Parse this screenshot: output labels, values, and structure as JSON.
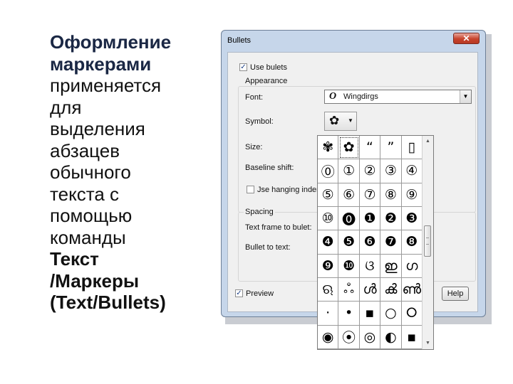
{
  "slide": {
    "title_line1": "Оформление",
    "title_line2": "маркерами",
    "body_lines": [
      "применяется",
      "для",
      "выделения",
      "абзацев",
      "обычного",
      "текста с",
      "помощью",
      "команды"
    ],
    "command_line1": "Текст",
    "command_line2": "/Маркеры",
    "command_line3": "(Text/Bullets)"
  },
  "dialog": {
    "title": "Bullets",
    "close_glyph": "✕",
    "use_bullets_label": "Use bulets",
    "use_bullets_checked": true,
    "appearance_label": "Appearance",
    "font_label": "Font:",
    "font_value": "Wingdirgs",
    "font_type_glyph": "O",
    "symbol_label": "Symbol:",
    "symbol_glyph": "✿",
    "size_label": "Size:",
    "baseline_label": "Baseline shift:",
    "hanging_label": "Jse hanging indent",
    "hanging_checked": false,
    "spacing_label": "Spacing",
    "text_frame_label": "Text frame to bulet:",
    "bullet_to_text_label": "Bullet to text:",
    "preview_label": "Preview",
    "preview_checked": true,
    "help_label": "Help",
    "dropdown_arrow": "▼",
    "checkmark": "✓"
  },
  "picker": {
    "symbols": [
      "✾",
      "✿",
      "“",
      "”",
      "▯",
      "⓪",
      "①",
      "②",
      "③",
      "④",
      "⑤",
      "⑥",
      "⑦",
      "⑧",
      "⑨",
      "⑩",
      "⓿",
      "❶",
      "❷",
      "❸",
      "❹",
      "❺",
      "❻",
      "❼",
      "❽",
      "❾",
      "❿",
      "ଓ",
      "ഇ",
      "ഗ",
      "ଋ",
      "ஃ",
      "ൾ",
      "ൿ",
      "ൺ",
      "·",
      "•",
      "▪",
      "○",
      "⭘",
      "◉",
      "⦿",
      "◎",
      "◐",
      "▪"
    ],
    "selected_index": 1,
    "scroll_up": "▲",
    "scroll_down": "▼"
  }
}
